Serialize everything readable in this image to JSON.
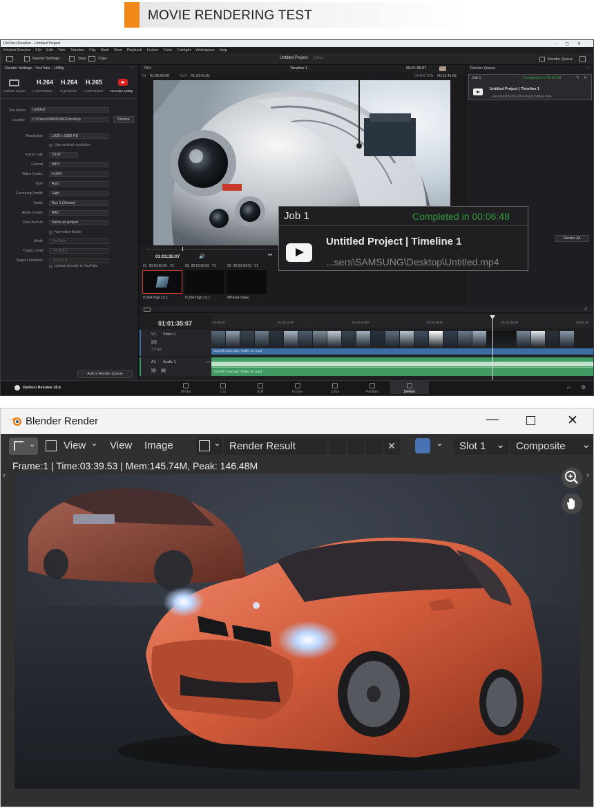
{
  "banner": {
    "title": "MOVIE RENDERING TEST",
    "accent_color": "#ef8a1a"
  },
  "resolve": {
    "window_title": "DaVinci Resolve - Untitled Project",
    "menus": [
      "DaVinci Resolve",
      "File",
      "Edit",
      "Trim",
      "Timeline",
      "Clip",
      "Mark",
      "View",
      "Playback",
      "Fusion",
      "Color",
      "Fairlight",
      "Workspace",
      "Help"
    ],
    "toolbar": {
      "render_settings": "Render Settings",
      "tape": "Tape",
      "clips": "Clips",
      "project_name": "Untitled Project",
      "edited": "Edited",
      "render_queue_btn": "Render Queue"
    },
    "left_panel": {
      "header": "Render Settings - YouTube - 1080p",
      "presets": [
        {
          "label": "Custom Export",
          "badge": ""
        },
        {
          "label": "H.264 Master",
          "badge": "H.264"
        },
        {
          "label": "HyperDeck",
          "badge": "H.264"
        },
        {
          "label": "H.265 Master",
          "badge": "H.265"
        },
        {
          "label": "YouTube 1080p",
          "badge": ""
        }
      ],
      "file_name_label": "File Name",
      "file_name": "Untitled",
      "location_label": "Location",
      "location": "C:\\Users\\SAMSUNG\\Desktop",
      "browse": "Browse",
      "settings": [
        {
          "label": "Resolution",
          "value": "1920 x 1080 HD",
          "dim": false
        },
        {
          "label": "Frame rate",
          "value": "29.97",
          "dim": false
        },
        {
          "label": "Format",
          "value": "MP4",
          "dim": false
        },
        {
          "label": "Video Codec",
          "value": "H.264",
          "dim": false
        },
        {
          "label": "Type",
          "value": "Auto",
          "dim": false
        },
        {
          "label": "Encoding Profile",
          "value": "High",
          "dim": false
        },
        {
          "label": "Audio",
          "value": "Bus 1 (Stereo)",
          "dim": false
        },
        {
          "label": "Audio Codec",
          "value": "AAC",
          "dim": false
        },
        {
          "label": "Data burn-in",
          "value": "Same as project",
          "dim": false
        },
        {
          "label": "Mode",
          "value": "YouTube",
          "dim": true
        },
        {
          "label": "Target Level",
          "value": "-14   dBFS",
          "dim": true
        },
        {
          "label": "Target Loudness",
          "value": "-14   LKFS",
          "dim": true
        }
      ],
      "use_vertical": "Use vertical resolution",
      "normalize_audio": "Normalize Audio",
      "upload_youtube": "Upload directly to YouTube",
      "add_to_queue": "Add to Render Queue",
      "app_version": "DaVinci Resolve 18.6"
    },
    "viewer": {
      "zoom": "75%",
      "timeline_name": "Timeline 1",
      "timecode_top": "00:01:35:07",
      "in_label": "IN",
      "in_tc": "01:00:00:00",
      "out_label": "OUT",
      "out_tc": "01:13:41:01",
      "duration_label": "DURATION",
      "duration_tc": "00:13:41:02",
      "playhead_tc": "01:01:35:07"
    },
    "clips": [
      {
        "num": "01",
        "tc": "00:00:00:00",
        "track": "V1",
        "name": "H.264 High L5.1"
      },
      {
        "num": "02",
        "tc": "00:00:00:00",
        "track": "V1",
        "name": "H.264 High L5.1"
      },
      {
        "num": "03",
        "tc": "00:00:00:00",
        "track": "V1",
        "name": "MPEG4 Video"
      }
    ],
    "timeline": {
      "timecode": "01:01:35:07",
      "ruler": [
        "01:00:00",
        "01:01:12:00",
        "01:01:20:00",
        "01:01:28:00",
        "01:01:36:00",
        "01:01:44:"
      ],
      "video_track": {
        "id": "V1",
        "name": "Video 1",
        "clips_count": "3 Clips",
        "clip_label": "Starfall Cinematic Trailer 4K.mp4"
      },
      "audio_track": {
        "id": "A1",
        "name": "Audio 1",
        "level": "2.0",
        "clip_label": "Starfall Cinematic Trailer 4K.mp4"
      }
    },
    "render_queue": {
      "title": "Render Queue",
      "job": "Job 1",
      "status": "Completed in 00:06:48",
      "project": "Untitled Project | Timeline 1",
      "path": "...sers\\SAMSUNG\\Desktop\\Untitled.mp4",
      "render_all": "Render All"
    },
    "pages": [
      "Media",
      "Cut",
      "Edit",
      "Fusion",
      "Color",
      "Fairlight",
      "Deliver"
    ],
    "active_page": "Deliver"
  },
  "popup": {
    "job": "Job 1",
    "status": "Completed in 00:06:48",
    "status_color": "#2f9a3a",
    "project": "Untitled Project | Timeline 1",
    "path": "...sers\\SAMSUNG\\Desktop\\Untitled.mp4"
  },
  "blender": {
    "window_title": "Blender Render",
    "header": {
      "view_menu": "View",
      "view": "View",
      "image": "Image",
      "image_name": "Render Result",
      "slot": "Slot 1",
      "pass": "Composite"
    },
    "status": "Frame:1 | Time:03:39.53 | Mem:145.74M, Peak: 146.48M"
  }
}
